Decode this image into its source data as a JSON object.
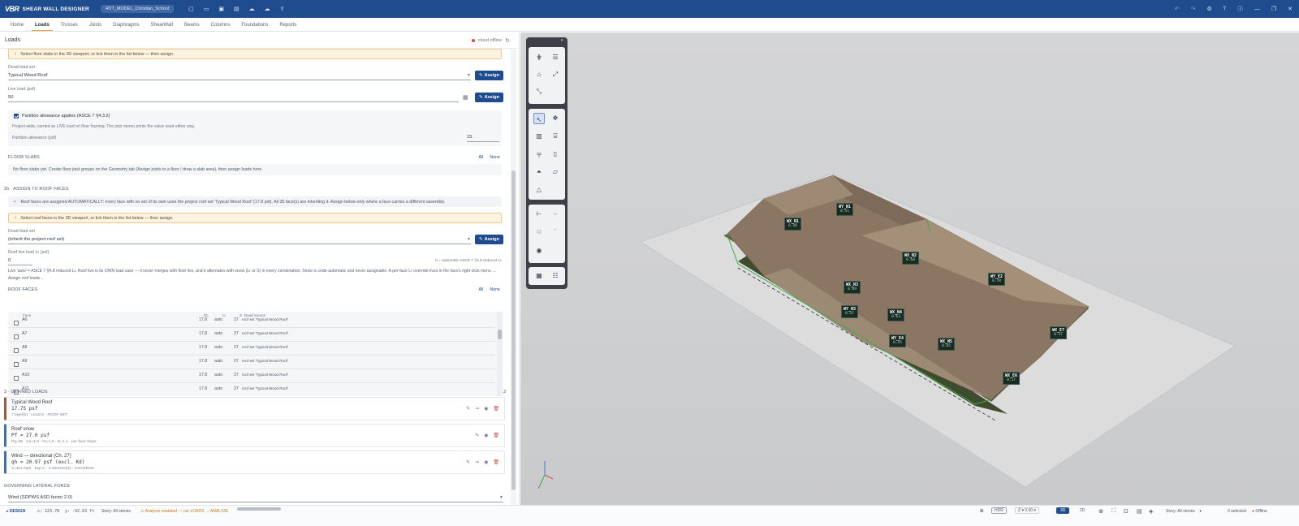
{
  "app": {
    "brand_mark": "VBR",
    "title": "SHEAR WALL DESIGNER",
    "project": "RVT_MODEL_Christian_School"
  },
  "tabs": [
    "Home",
    "Loads",
    "Trusses",
    "Joists",
    "Diaphragms",
    "ShearWall",
    "Beams",
    "Columns",
    "Foundations",
    "Reports"
  ],
  "active_tab": "Loads",
  "panel": {
    "title": "Loads",
    "cloud_status": "cloud offline"
  },
  "floor": {
    "warn_select": "Select floor slabs in the 3D viewport, or tick them in the list below — then assign.",
    "dead_label": "Dead-load set",
    "dead_value": "Typical Wood Roof",
    "live_label": "Live load (psf)",
    "live_value": "50",
    "assign": "Assign",
    "partition_label": "Partition allowance applies (ASCE 7 §4.3.2)",
    "partition_note": "Project-wide, carried as LIVE load on floor framing. The joist memo prints the value used either way.",
    "partition_allow_label": "Partition allowance (psf)",
    "partition_allow_value": "15",
    "slabs_head": "FLOOR SLABS",
    "all": "All",
    "none": "None",
    "slabs_empty": "No floor slabs yet. Create floor joist groups on the Geometry tab (Assign joists to a floor / draw a slab area), then assign loads here."
  },
  "roof": {
    "section": "2b · ASSIGN TO ROOF FACES",
    "auto_info": "Roof faces are assigned AUTOMATICALLY: every face with no set of its own uses the project roof set 'Typical Wood Roof' (17.8 psf). All 35 face(s) are inheriting it. Assign below only where a face carries a different assembly.",
    "warn_select": "Select roof faces in the 3D viewport, or tick them in the list below — then assign.",
    "dead_label": "Dead-load set",
    "dead_value": "(inherit the project roof set)",
    "lr_label": "Roof live load Lr (psf)",
    "lr_value": "0",
    "lr_hint": "0 = automatic ASCE 7 §4.8 reduced Lr",
    "lr_note": "Live 'auto' = ASCE 7 §4.8 reduced Lr. Roof live is its OWN load case — it never merges with floor live, and it alternates with snow (Lr or S) in every combination. Snow is code-automatic and never assignable. A per-face Lr override lives in the face's right-click menu → Assign roof loads...",
    "faces_head": "ROOF FACES",
    "cols": {
      "face": "Face",
      "dl": "DL",
      "lr": "Lr",
      "s": "S",
      "src": "Dead source"
    },
    "rows": [
      {
        "face": "A6",
        "dl": "17.8",
        "lr": "auto",
        "s": "27",
        "src": "roof set 'Typical Wood Roof'"
      },
      {
        "face": "A7",
        "dl": "17.8",
        "lr": "auto",
        "s": "27",
        "src": "roof set 'Typical Wood Roof'"
      },
      {
        "face": "A8",
        "dl": "17.8",
        "lr": "auto",
        "s": "27",
        "src": "roof set 'Typical Wood Roof'"
      },
      {
        "face": "A9",
        "dl": "17.8",
        "lr": "auto",
        "s": "27",
        "src": "roof set 'Typical Wood Roof'"
      },
      {
        "face": "A10",
        "dl": "17.8",
        "lr": "auto",
        "s": "27",
        "src": "roof set 'Typical Wood Roof'"
      },
      {
        "face": "A11",
        "dl": "17.8",
        "lr": "auto",
        "s": "27",
        "src": "roof set 'Typical Wood Roof'"
      }
    ]
  },
  "defined": {
    "section": "3 · DEFINED LOADS",
    "count": "3",
    "cards": [
      {
        "name": "Typical Wood Roof",
        "value": "17.75 psf",
        "desc": "7 layer(s) · Local X · ROOF SET",
        "color": "#9c5a43"
      },
      {
        "name": "Roof snow",
        "value": "Pf = 27.0 psf",
        "desc": "Pg=35 · Ce=1.0 · Ct=1.0 · Is=1.1 · per-face slope",
        "color": "#3f6fb5"
      },
      {
        "name": "Wind — directional (Ch. 27)",
        "value": "qh = 20.97 psf (excl. Kd)",
        "desc": "V=114 mph · Exp C · 2 direction(s) · GOVERNS",
        "color": "#3f6fb5"
      }
    ]
  },
  "governing": {
    "section": "GOVERNING LATERAL FORCE",
    "value": "Wind (SDPWS ASD factor 2.0)"
  },
  "status": {
    "design": "DESIGN",
    "x": "x: 123.78",
    "y": "y: -92.63 ft",
    "story": "Story: All stories",
    "analysis": "Analysis outdated — run LOADS → ANALYZE",
    "hdr": "HDR",
    "z": "Z",
    "zval": "0.00",
    "view3d": "3D",
    "view2d": "2D",
    "story_right_label": "Story:",
    "story_right_value": "All stories",
    "selected": "0 selected",
    "offline": "Offline"
  },
  "tags": [
    {
      "name": "WX_N1",
      "value": "0.48"
    },
    {
      "name": "WY_N1",
      "value": "0.51"
    },
    {
      "name": "WX_N2",
      "value": "0.68"
    },
    {
      "name": "WY_E2",
      "value": "0.70"
    },
    {
      "name": "WX_N3",
      "value": "0.89"
    },
    {
      "name": "WY_N3",
      "value": "0.47"
    },
    {
      "name": "WX_N4",
      "value": "0.63"
    },
    {
      "name": "WY_E4",
      "value": "0.45"
    },
    {
      "name": "WX_N5",
      "value": "0.65"
    },
    {
      "name": "WX_E7",
      "value": "0.37"
    },
    {
      "name": "WX_E6",
      "value": "0.17"
    }
  ]
}
